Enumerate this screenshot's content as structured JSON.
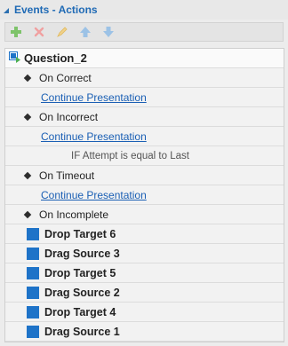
{
  "header": {
    "title": "Events - Actions"
  },
  "toolbar": {
    "buttons": [
      "add-icon",
      "delete-icon",
      "edit-icon",
      "move-up-icon",
      "move-down-icon"
    ]
  },
  "tree": {
    "root": "Question_2",
    "items": [
      {
        "kind": "event",
        "label": "On Correct"
      },
      {
        "kind": "action",
        "label": "Continue Presentation"
      },
      {
        "kind": "event",
        "label": "On Incorrect"
      },
      {
        "kind": "action",
        "label": "Continue Presentation"
      },
      {
        "kind": "condition",
        "label": "IF Attempt is equal to Last"
      },
      {
        "kind": "event",
        "label": "On Timeout"
      },
      {
        "kind": "action",
        "label": "Continue Presentation"
      },
      {
        "kind": "event",
        "label": "On Incomplete"
      },
      {
        "kind": "object",
        "label": "Drop Target 6"
      },
      {
        "kind": "object",
        "label": "Drag Source 3"
      },
      {
        "kind": "object",
        "label": "Drop Target 5"
      },
      {
        "kind": "object",
        "label": "Drag Source 2"
      },
      {
        "kind": "object",
        "label": "Drop Target 4"
      },
      {
        "kind": "object",
        "label": "Drag Source 1"
      }
    ]
  },
  "colors": {
    "accent": "#1f6ab5",
    "object": "#1e73c8",
    "link": "#1a5fb4"
  }
}
